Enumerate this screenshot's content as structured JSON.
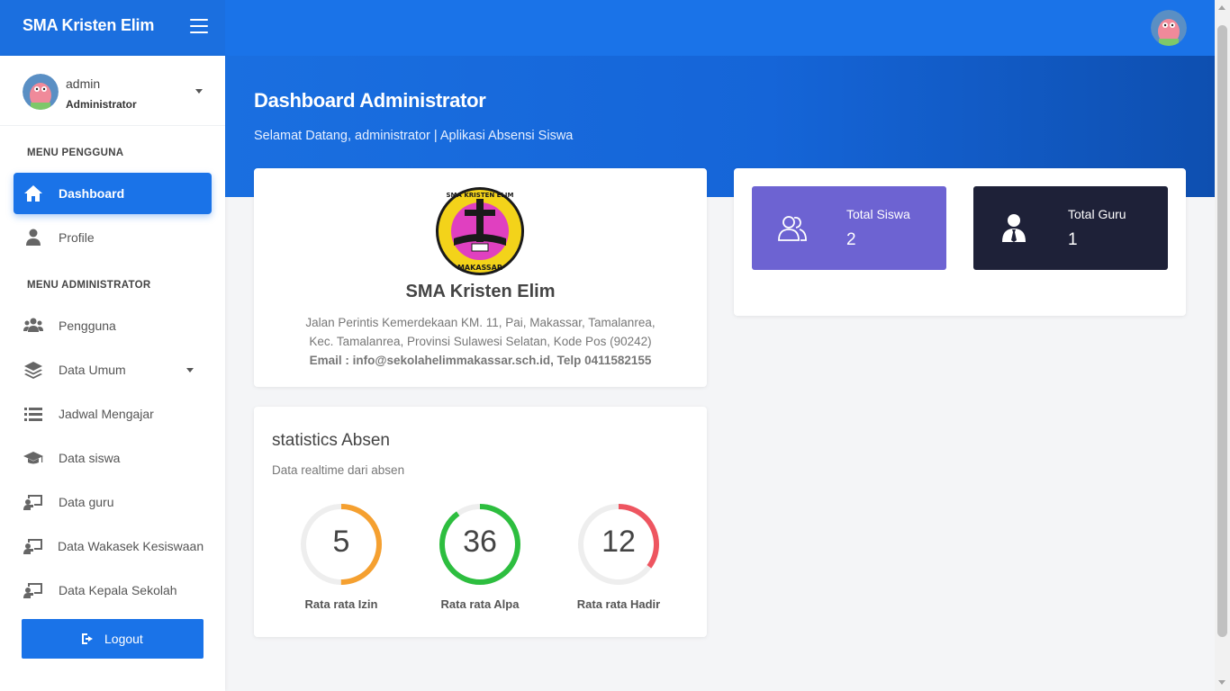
{
  "brand": {
    "title": "SMA Kristen Elim"
  },
  "user": {
    "name": "admin",
    "role": "Administrator"
  },
  "sidebar": {
    "section_user": "MENU PENGGUNA",
    "section_admin": "MENU ADMINISTRATOR",
    "items": [
      {
        "label": "Dashboard",
        "icon": "home-icon"
      },
      {
        "label": "Profile",
        "icon": "user-icon"
      },
      {
        "label": "Pengguna",
        "icon": "users-icon"
      },
      {
        "label": "Data Umum",
        "icon": "layers-icon"
      },
      {
        "label": "Jadwal Mengajar",
        "icon": "list-icon"
      },
      {
        "label": "Data siswa",
        "icon": "graduation-cap-icon"
      },
      {
        "label": "Data guru",
        "icon": "chalkboard-teacher-icon"
      },
      {
        "label": "Data Wakasek Kesiswaan",
        "icon": "chalkboard-teacher-icon"
      },
      {
        "label": "Data Kepala Sekolah",
        "icon": "chalkboard-teacher-icon"
      }
    ],
    "logout_label": "Logout"
  },
  "hero": {
    "title": "Dashboard Administrator",
    "subtitle": "Selamat Datang, administrator | Aplikasi Absensi Siswa"
  },
  "school": {
    "name": "SMA Kristen Elim",
    "address_line1": "Jalan Perintis Kemerdekaan KM. 11, Pai, Makassar, Tamalanrea,",
    "address_line2": "Kec. Tamalanrea, Provinsi Sulawesi Selatan, Kode Pos (90242)",
    "contact": "Email : info@sekolahelimmakassar.sch.id, Telp 0411582155",
    "logo_text_top": "SMA KRISTEN ELIM",
    "logo_text_bottom": "MAKASSAR"
  },
  "stats": [
    {
      "label": "Total Siswa",
      "value": "2",
      "color": "#6d63d2",
      "icon": "users-outline-icon"
    },
    {
      "label": "Total Guru",
      "value": "1",
      "color": "#1e2138",
      "icon": "user-tie-icon"
    }
  ],
  "absen": {
    "title": "statistics Absen",
    "subtitle": "Data realtime dari absen",
    "gauges": [
      {
        "value": "5",
        "label": "Rata rata Izin",
        "color": "#f5a030",
        "fraction": 0.5
      },
      {
        "value": "36",
        "label": "Rata rata Alpa",
        "color": "#2dbe3f",
        "fraction": 0.9
      },
      {
        "value": "12",
        "label": "Rata rata Hadir",
        "color": "#ee5560",
        "fraction": 0.35
      }
    ]
  },
  "colors": {
    "primary": "#1a73e8",
    "track": "#eeeeee"
  }
}
